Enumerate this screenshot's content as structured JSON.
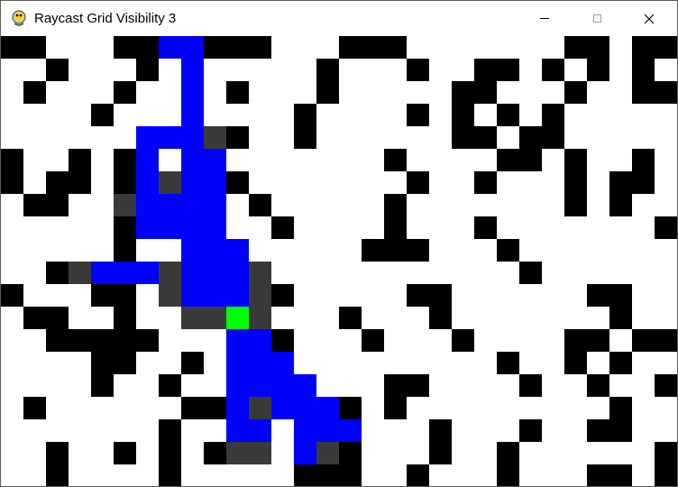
{
  "window": {
    "title": "Raycast Grid Visibility 3",
    "controls": {
      "minimize": "minimize",
      "maximize": "maximize",
      "close": "close"
    }
  },
  "colors": {
    "wall": "#000000",
    "wall_visible_edge": "#3a3a3a",
    "visible_area": "#0000ff",
    "player": "#00ff00",
    "empty": "#ffffff"
  },
  "grid": {
    "columns": 30,
    "rows": 20,
    "legend": {
      "#": "wall",
      "D": "visible wall edge",
      "B": "visible cell",
      "G": "player",
      ".": "empty"
    },
    "cells": [
      "##...##..###...###.......##.##",
      "..#...#.......#...#..##.#.#.#.",
      ".#...#....#...#.....##...#..##",
      "....#........#....#.#.#.#.....",
      "......##..#..#......##.##.....",
      "#..#.#...........#....##.#..#.",
      "#.##.#....#.......#..#...#.##.",
      ".##........#.....#.......#.#..",
      ".....#..#...#....#...#.......#",
      ".....#..........###...#.......",
      "..#....................#......",
      "#...##......#.....##......##..",
      ".##..#.........#...#.......#..",
      "..#####.....#...#...#....##.##",
      "....##..#.............#..#.#..",
      "....#..#.........##....#..#..#",
      ".#......###....#.#.........#..",
      ".......#...........#...#..##..",
      "..#..#.#.#....##...#..#......#",
      "..#....#.....###..#...#...##.#"
    ],
    "visible_cells": [
      [
        0,
        7
      ],
      [
        0,
        8
      ],
      [
        1,
        8
      ],
      [
        2,
        8
      ],
      [
        3,
        8
      ],
      [
        4,
        6
      ],
      [
        4,
        7
      ],
      [
        4,
        8
      ],
      [
        5,
        6
      ],
      [
        5,
        8
      ],
      [
        5,
        9
      ],
      [
        6,
        6
      ],
      [
        6,
        7
      ],
      [
        6,
        8
      ],
      [
        6,
        9
      ],
      [
        7,
        5
      ],
      [
        7,
        6
      ],
      [
        7,
        7
      ],
      [
        7,
        8
      ],
      [
        7,
        9
      ],
      [
        8,
        6
      ],
      [
        8,
        7
      ],
      [
        8,
        8
      ],
      [
        8,
        9
      ],
      [
        9,
        8
      ],
      [
        9,
        9
      ],
      [
        9,
        10
      ],
      [
        10,
        4
      ],
      [
        10,
        5
      ],
      [
        10,
        6
      ],
      [
        10,
        7
      ],
      [
        10,
        8
      ],
      [
        10,
        9
      ],
      [
        10,
        10
      ],
      [
        11,
        8
      ],
      [
        11,
        9
      ],
      [
        11,
        10
      ],
      [
        12,
        10
      ],
      [
        13,
        10
      ],
      [
        13,
        11
      ],
      [
        14,
        10
      ],
      [
        14,
        11
      ],
      [
        14,
        12
      ],
      [
        15,
        10
      ],
      [
        15,
        11
      ],
      [
        15,
        12
      ],
      [
        15,
        13
      ],
      [
        16,
        10
      ],
      [
        16,
        12
      ],
      [
        16,
        13
      ],
      [
        16,
        14
      ],
      [
        17,
        10
      ],
      [
        17,
        11
      ],
      [
        17,
        13
      ],
      [
        17,
        14
      ],
      [
        17,
        15
      ],
      [
        18,
        13
      ],
      [
        18,
        14
      ]
    ],
    "visible_wall_edges": [
      [
        4,
        9
      ],
      [
        6,
        7
      ],
      [
        7,
        5
      ],
      [
        10,
        7
      ],
      [
        10,
        3
      ],
      [
        10,
        11
      ],
      [
        11,
        11
      ],
      [
        11,
        7
      ],
      [
        12,
        8
      ],
      [
        12,
        9
      ],
      [
        12,
        11
      ],
      [
        16,
        11
      ],
      [
        18,
        10
      ],
      [
        18,
        11
      ],
      [
        18,
        14
      ]
    ],
    "player": [
      12,
      10
    ]
  }
}
